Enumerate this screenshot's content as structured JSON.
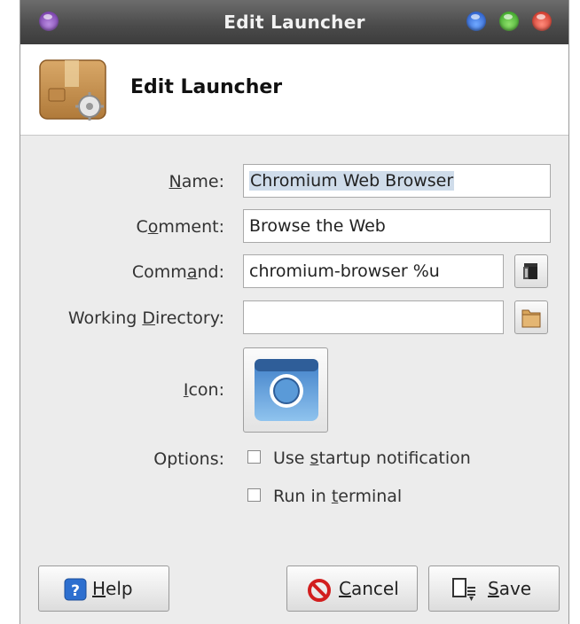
{
  "window": {
    "title": "Edit Launcher"
  },
  "header": {
    "heading": "Edit Launcher",
    "icon": "package-settings-icon"
  },
  "form": {
    "name_label_pre": "",
    "name_label_ul": "N",
    "name_label_post": "ame:",
    "name_value": "Chromium Web Browser",
    "comment_label_pre": "C",
    "comment_label_ul": "o",
    "comment_label_post": "mment:",
    "comment_value": "Browse the Web",
    "command_label_pre": "Comm",
    "command_label_ul": "a",
    "command_label_post": "nd:",
    "command_value": "chromium-browser %u",
    "workdir_label_pre": "Working ",
    "workdir_label_ul": "D",
    "workdir_label_post": "irectory:",
    "workdir_value": "",
    "icon_label_pre": "",
    "icon_label_ul": "I",
    "icon_label_post": "con:",
    "icon_value": "chromium-icon",
    "options_label": "Options:",
    "startup_pre": "Use ",
    "startup_ul": "s",
    "startup_post": "tartup notification",
    "startup_checked": false,
    "terminal_pre": "Run in ",
    "terminal_ul": "t",
    "terminal_post": "erminal",
    "terminal_checked": false
  },
  "buttons": {
    "help_ul": "H",
    "help_post": "elp",
    "cancel_ul": "C",
    "cancel_post": "ancel",
    "save_ul": "S",
    "save_post": "ave"
  },
  "colors": {
    "titlebar": "#4a4a4a",
    "window_bg": "#ececec",
    "selection": "#cfdcea"
  }
}
